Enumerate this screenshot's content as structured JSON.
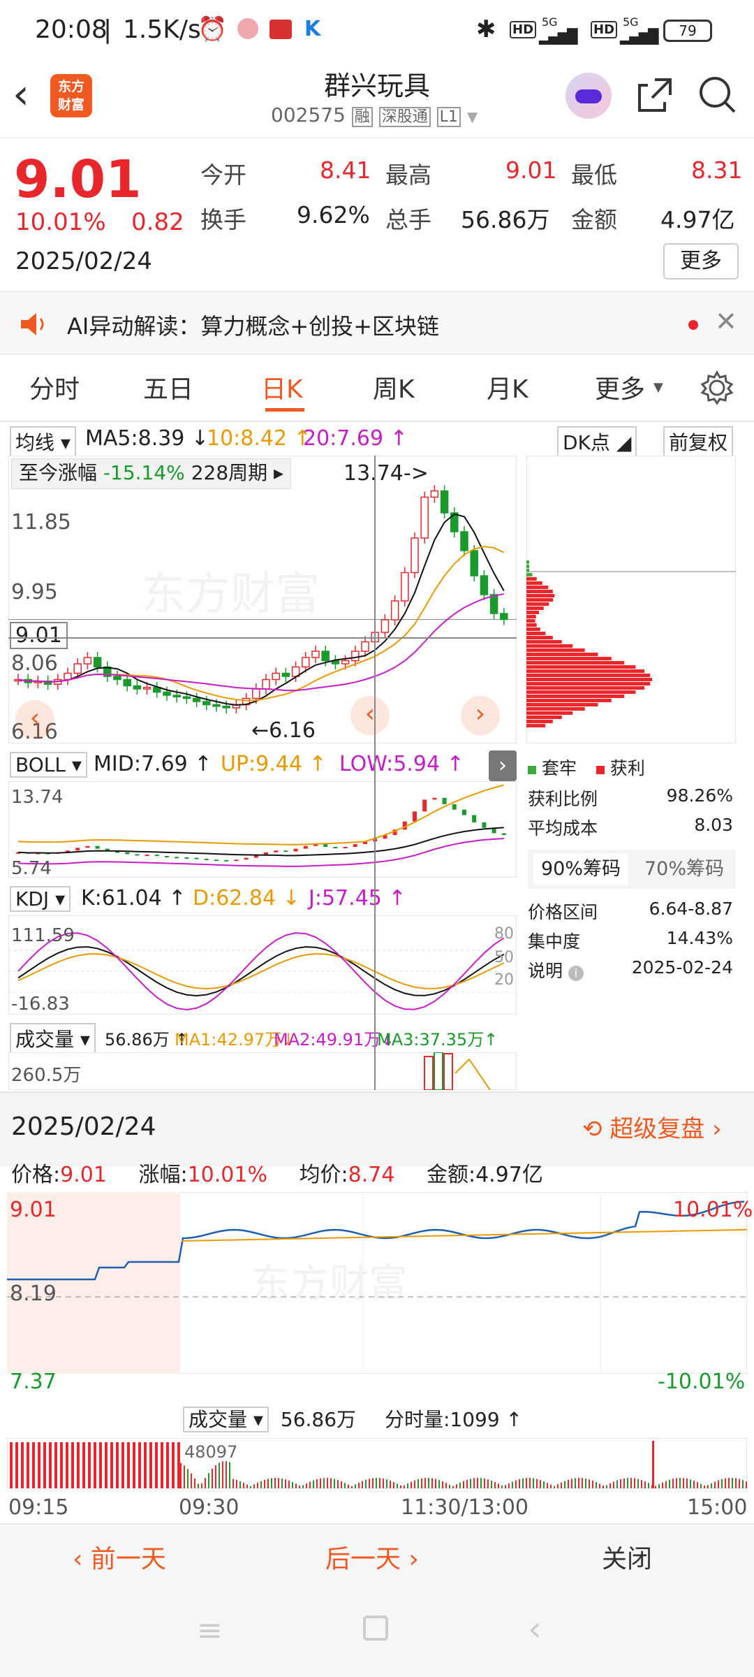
{
  "status_bar": {
    "time": "20:08",
    "speed": "1.5K/s",
    "battery": "79",
    "net1": "5G",
    "net2": "5G"
  },
  "header": {
    "logo_line1": "东方",
    "logo_line2": "财富",
    "stock_name": "群兴玩具",
    "stock_code": "002575",
    "tag1": "融",
    "tag2": "深股通",
    "tag3": "L1"
  },
  "quote": {
    "price": "9.01",
    "change_pct": "10.01%",
    "change": "0.82",
    "date": "2025/02/24",
    "open_label": "今开",
    "open": "8.41",
    "high_label": "最高",
    "high": "9.01",
    "low_label": "最低",
    "low": "8.31",
    "turnover_label": "换手",
    "turnover": "9.62%",
    "volume_label": "总手",
    "volume": "56.86万",
    "amount_label": "金额",
    "amount": "4.97亿",
    "more": "更多"
  },
  "ai_banner": {
    "text": "AI异动解读：算力概念+创投+区块链"
  },
  "tabs": [
    "分时",
    "五日",
    "日K",
    "周K",
    "月K",
    "更多"
  ],
  "kline": {
    "ma_select": "均线",
    "ma5": "MA5:8.39 ↓",
    "ma10": "10:8.42 ↑",
    "ma20": "20:7.69 ↑",
    "dk": "DK点",
    "fq": "前复权",
    "since_label": "至今涨幅",
    "since_value": "-15.14%",
    "period": "228周期",
    "max_label": "13.74->",
    "min_label": "←6.16",
    "y1": "11.85",
    "y2": "9.95",
    "y3": "8.06",
    "y4": "6.16",
    "cur": "9.01"
  },
  "boll": {
    "select": "BOLL",
    "mid": "MID:7.69 ↑",
    "up": "UP:9.44 ↑",
    "low": "LOW:5.94 ↑",
    "y_top": "13.74",
    "y_bot": "5.74"
  },
  "kdj": {
    "select": "KDJ",
    "k": "K:61.04 ↑",
    "d": "D:62.84 ↓",
    "j": "J:57.45 ↑",
    "y_top": "111.59",
    "y_bot": "-16.83",
    "l80": "80",
    "l50": "50",
    "l20": "20"
  },
  "vol": {
    "select": "成交量",
    "v": "56.86万 ↑",
    "ma1": "MA1:42.97万↓",
    "ma2": "MA2:49.91万↓",
    "ma3": "MA3:37.35万↑",
    "y_top": "260.5万"
  },
  "chips": {
    "legend_trap": "套牢",
    "legend_profit": "获利",
    "profit_ratio_label": "获利比例",
    "profit_ratio": "98.26%",
    "avg_cost_label": "平均成本",
    "avg_cost": "8.03",
    "tab90": "90%筹码",
    "tab70": "70%筹码",
    "range_label": "价格区间",
    "range": "6.64-8.87",
    "conc_label": "集中度",
    "conc": "14.43%",
    "note_label": "说明",
    "note_date": "2025-02-24"
  },
  "intraday": {
    "date": "2025/02/24",
    "replay": "超级复盘",
    "price_label": "价格:",
    "price": "9.01",
    "chg_label": "涨幅:",
    "chg": "10.01%",
    "avg_label": "均价:",
    "avg": "8.74",
    "amt_label": "金额:",
    "amt": "4.97亿",
    "y_top": "9.01",
    "y_mid": "8.19",
    "y_bot": "7.37",
    "pct_top": "10.01%",
    "pct_bot": "-10.01%",
    "vol_select": "成交量",
    "vol": "56.86万",
    "tick_label": "分时量:",
    "tick": "1099 ↑",
    "vol_max": "48097",
    "t1": "09:15",
    "t2": "09:30",
    "t3": "11:30/13:00",
    "t4": "15:00"
  },
  "bottom": {
    "prev": "前一天",
    "next": "后一天",
    "close": "关闭"
  },
  "watermark": "东方财富",
  "colors": {
    "up": "#e8272c",
    "down": "#1a9a2c",
    "ma10": "#e89a00",
    "ma20": "#c81cc8",
    "accent": "#ff6a00"
  }
}
